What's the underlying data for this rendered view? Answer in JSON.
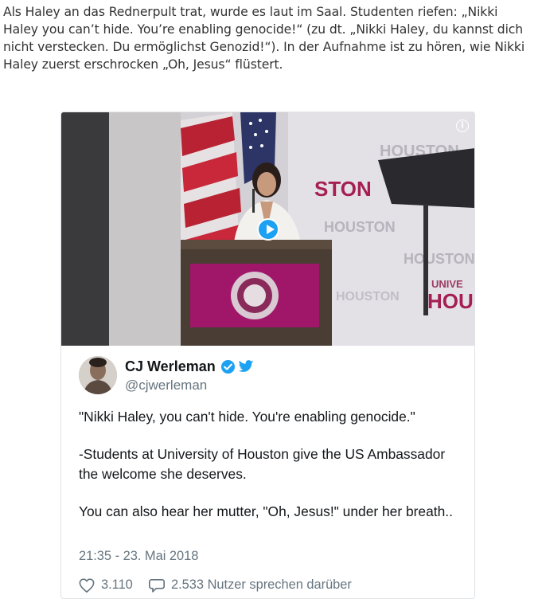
{
  "article": {
    "paragraph": "Als Haley an das Rednerpult trat, wurde es laut im Saal. Studenten riefen: „Nikki Haley you can’t hide. You’re enabling genocide!“ (zu dt. „Nikki Haley, du kannst dich nicht verstecken. Du ermöglichst Genozid!“). In der Aufnahme ist zu hören, wie Nikki Haley zuerst erschrocken „Oh, Jesus“ flüstert."
  },
  "video": {
    "info_icon": "info-icon",
    "play_icon": "play-icon",
    "backdrop_text": {
      "line1": "HOUSTON",
      "line2": "STON",
      "line3": "HOUSTON",
      "line4": "UNIVE",
      "line5": "HOU"
    }
  },
  "tweet": {
    "author_name": "CJ Werleman",
    "handle": "@cjwerleman",
    "verified_icon": "verified-badge-icon",
    "platform_icon": "twitter-bird-icon",
    "body": [
      "\"Nikki Haley, you can't hide. You're enabling genocide.\"",
      "-Students at University of Houston give the US Ambassador the welcome she deserves.",
      "You can also hear her mutter, \"Oh, Jesus!\" under her breath.."
    ],
    "timestamp": "21:35 - 23. Mai 2018",
    "likes": "3.110",
    "replies_label": "2.533 Nutzer sprechen darüber"
  },
  "colors": {
    "twitter_blue": "#1da1f2",
    "muted_text": "#66757f",
    "podium_screen": "#a0176a"
  }
}
